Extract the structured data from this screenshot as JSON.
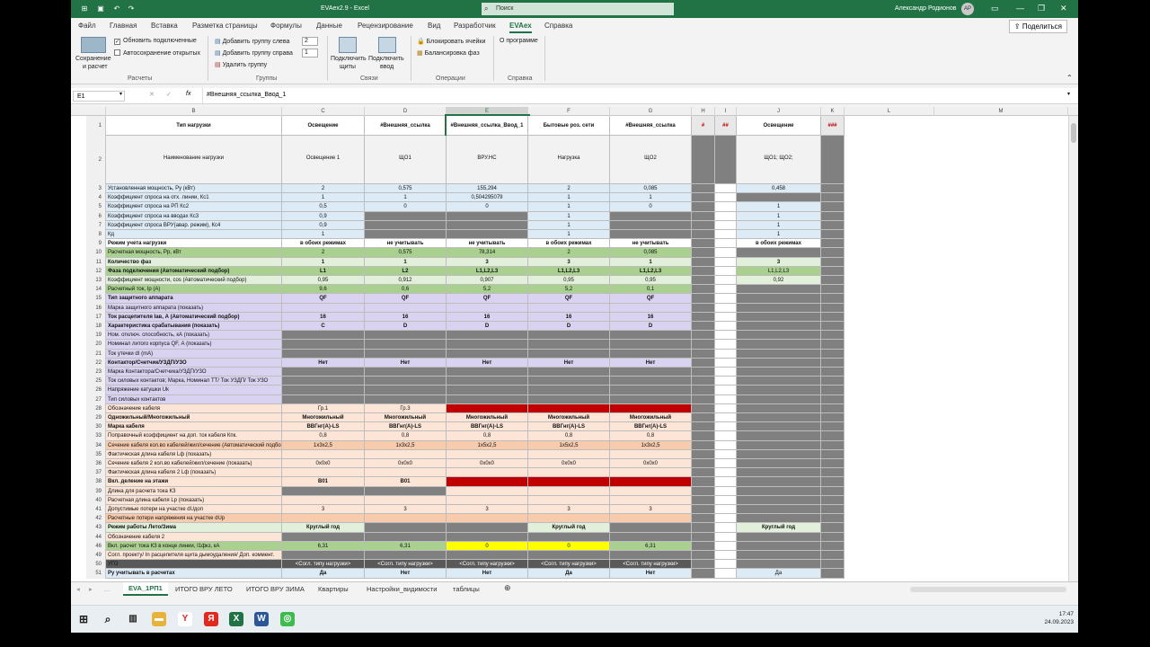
{
  "window": {
    "title": "EVAex2.9 - Excel",
    "search_placeholder": "Поиск",
    "user": "Александр Родионов",
    "avatar": "АР"
  },
  "ribbon_tabs": [
    "Файл",
    "Главная",
    "Вставка",
    "Разметка страницы",
    "Формулы",
    "Данные",
    "Рецензирование",
    "Вид",
    "Разработчик",
    "EVAex",
    "Справка"
  ],
  "active_tab": "EVAex",
  "share_label": "Поделиться",
  "ribbon": {
    "save_calc": [
      "Сохранение",
      "и расчет"
    ],
    "update_links": "Обновить подключенные",
    "autosave": "Автосохранение открытых",
    "add_group_left": "Добавить группу слева",
    "add_group_right": "Добавить группу справа",
    "delete_group": "Удалить группу",
    "spin_left": "2",
    "spin_right": "1",
    "connect_shields": [
      "Подключить",
      "щиты"
    ],
    "connect_input": [
      "Подключить",
      "ввод"
    ],
    "lock_cells": "Блокировать ячейки",
    "balance_phases": "Балансировка фаз",
    "about": "О программе",
    "groups": [
      "Расчеты",
      "Группы",
      "Связи",
      "Операции",
      "Справка"
    ]
  },
  "formula_bar": {
    "name_box": "E1",
    "formula": "#Внешняя_ссылка_Ввод_1"
  },
  "columns": [
    "B",
    "C",
    "D",
    "E",
    "F",
    "G",
    "H",
    "I",
    "J",
    "K",
    "L",
    "M"
  ],
  "header_row": {
    "C": "Освещение",
    "D": "#Внешняя_ссылка",
    "E": "#Внешняя_ссылка_Ввод_1",
    "F": "Бытовые роз. сети",
    "G": "#Внешняя_ссылка",
    "H": "#",
    "I": "##",
    "J": "Освещение",
    "K": "###",
    "B": "Тип нагрузки"
  },
  "name_row": {
    "B": "Наименование нагрузки",
    "C": "Освещение 1",
    "D": "ЩО1",
    "E": "ВРУ.НС",
    "F": "Нагрузка",
    "G": "ЩО2",
    "J": "ЩО1; ЩО2;"
  },
  "rows": [
    {
      "n": "3",
      "label": "Установленная мощность, Ру (кВт)",
      "C": "2",
      "D": "0,575",
      "E": "155,294",
      "F": "2",
      "G": "0,085",
      "J": "0,458"
    },
    {
      "n": "4",
      "label": "Коэффициент спроса на отх. линии, Кс1",
      "C": "1",
      "D": "1",
      "E": "0,504295079",
      "F": "1",
      "G": "1",
      "J": ""
    },
    {
      "n": "5",
      "label": "Коэффициент спроса на РП Кс2",
      "C": "0,5",
      "D": "0",
      "E": "0",
      "F": "1",
      "G": "0",
      "J": "1"
    },
    {
      "n": "6",
      "label": "Коэффициент спроса на вводах Кс3",
      "C": "0,9",
      "D": "",
      "E": "",
      "F": "1",
      "G": "",
      "J": "1"
    },
    {
      "n": "7",
      "label": "Коэффициент спроса ВРУ(авар. режим), Кс4",
      "C": "0,9",
      "D": "",
      "E": "",
      "F": "1",
      "G": "",
      "J": "1"
    },
    {
      "n": "8",
      "label": "Кд",
      "C": "1",
      "D": "",
      "E": "",
      "F": "1",
      "G": "",
      "J": "1"
    },
    {
      "n": "9",
      "label": "Режим учета нагрузки",
      "C": "в обоих режимах",
      "D": "не учитывать",
      "E": "не учитывать",
      "F": "в обоих режимах",
      "G": "не учитывать",
      "J": "в обоих режимах"
    },
    {
      "n": "10",
      "label": "Расчетная мощность, Рр, кВт",
      "C": "2",
      "D": "0,575",
      "E": "78,314",
      "F": "2",
      "G": "0,085",
      "J": ""
    },
    {
      "n": "11",
      "label": "Количество фаз",
      "C": "1",
      "D": "1",
      "E": "3",
      "F": "3",
      "G": "1",
      "J": "3"
    },
    {
      "n": "12",
      "label": "Фаза подключения (Автоматический подбор)",
      "C": "L1",
      "D": "L2",
      "E": "L1,L2,L3",
      "F": "L1,L2,L3",
      "G": "L1,L2,L3",
      "J": "L1,L2,L3"
    },
    {
      "n": "13",
      "label": "Коэффициент мощности, cos (Автоматический подбор)",
      "C": "0,95",
      "D": "0,912",
      "E": "0,907",
      "F": "0,95",
      "G": "0,95",
      "J": "0,92"
    },
    {
      "n": "14",
      "label": "Расчетный ток, Ip (A)",
      "C": "9,6",
      "D": "0,6",
      "E": "5,2",
      "F": "5,2",
      "G": "0,1",
      "J": ""
    },
    {
      "n": "15",
      "label": "Тип защитного аппарата",
      "C": "QF",
      "D": "QF",
      "E": "QF",
      "F": "QF",
      "G": "QF",
      "J": ""
    },
    {
      "n": "16",
      "label": "Марка защитного аппарата (показать)",
      "C": "",
      "D": "",
      "E": "",
      "F": "",
      "G": "",
      "J": ""
    },
    {
      "n": "17",
      "label": "Ток расцепителя Iав, А (Автоматический подбор)",
      "C": "16",
      "D": "16",
      "E": "16",
      "F": "16",
      "G": "16",
      "J": ""
    },
    {
      "n": "18",
      "label": "Характеристика срабатывания (показать)",
      "C": "C",
      "D": "D",
      "E": "D",
      "F": "D",
      "G": "D",
      "J": ""
    },
    {
      "n": "19",
      "label": "Ном. отключ. способность, кА (показать)",
      "C": "",
      "D": "",
      "E": "",
      "F": "",
      "G": "",
      "J": ""
    },
    {
      "n": "20",
      "label": "Номинал литого корпуса QF, А (показать)",
      "C": "",
      "D": "",
      "E": "",
      "F": "",
      "G": "",
      "J": ""
    },
    {
      "n": "21",
      "label": "Ток утечки dI (mA)",
      "C": "",
      "D": "",
      "E": "",
      "F": "",
      "G": "",
      "J": ""
    },
    {
      "n": "22",
      "label": "Контактор/Счетчик/УЗДП/УЗО",
      "C": "Нет",
      "D": "Нет",
      "E": "Нет",
      "F": "Нет",
      "G": "Нет",
      "J": ""
    },
    {
      "n": "23",
      "label": "Марка Контактора/Счетчика/УЗДП/УЗО",
      "C": "",
      "D": "",
      "E": "",
      "F": "",
      "G": "",
      "J": ""
    },
    {
      "n": "25",
      "label": "Ток силовых контактов; Марка, Номинал ТТ/ Ток УЗДП/ Ток УЗО",
      "C": "",
      "D": "",
      "E": "",
      "F": "",
      "G": "",
      "J": ""
    },
    {
      "n": "26",
      "label": "Напряжение катушки Uk",
      "C": "",
      "D": "",
      "E": "",
      "F": "",
      "G": "",
      "J": ""
    },
    {
      "n": "27",
      "label": "Тип силовых контактов",
      "C": "",
      "D": "",
      "E": "",
      "F": "",
      "G": "",
      "J": ""
    },
    {
      "n": "28",
      "label": "Обозначение кабеля",
      "C": "Гр.1",
      "D": "Гр.3",
      "E": "",
      "F": "",
      "G": "",
      "J": ""
    },
    {
      "n": "29",
      "label": "Одножильный/Многожильный",
      "C": "Многожильный",
      "D": "Многожильный",
      "E": "Многожильный",
      "F": "Многожильный",
      "G": "Многожильный",
      "J": ""
    },
    {
      "n": "30",
      "label": "Марка кабеля",
      "C": "ВВГнг(А)-LS",
      "D": "ВВГнг(А)-LS",
      "E": "ВВГнг(А)-LS",
      "F": "ВВГнг(А)-LS",
      "G": "ВВГнг(А)-LS",
      "J": ""
    },
    {
      "n": "33",
      "label": "Поправочный коэффициент на доп. ток кабеля Кпк.",
      "C": "0,8",
      "D": "0,8",
      "E": "0,8",
      "F": "0,8",
      "G": "0,8",
      "J": ""
    },
    {
      "n": "34",
      "label": "Сечение кабеля кол.во кабелей/жил/сечение (Автоматический подбор)",
      "C": "1х3х2,5",
      "D": "1х3х2,5",
      "E": "1х5х2,5",
      "F": "1х5х2,5",
      "G": "1х3х2,5",
      "J": ""
    },
    {
      "n": "35",
      "label": "Фактическая длина кабеля Lф (показать)",
      "C": "",
      "D": "",
      "E": "",
      "F": "",
      "G": "",
      "J": ""
    },
    {
      "n": "36",
      "label": "Сечение кабеля 2 кол.во кабелей/жил/сечение (показать)",
      "C": "0х0х0",
      "D": "0х0х0",
      "E": "0х0х0",
      "F": "0х0х0",
      "G": "0х0х0",
      "J": ""
    },
    {
      "n": "37",
      "label": "Фактическая длина кабеля 2 Lф (показать)",
      "C": "",
      "D": "",
      "E": "",
      "F": "",
      "G": "",
      "J": ""
    },
    {
      "n": "38",
      "label": "Вкл. деление на этажи",
      "C": "В01",
      "D": "В01",
      "E": "",
      "F": "",
      "G": "",
      "J": ""
    },
    {
      "n": "39",
      "label": "Длина для расчета тока КЗ",
      "C": "",
      "D": "",
      "E": "",
      "F": "",
      "G": "",
      "J": ""
    },
    {
      "n": "40",
      "label": "Расчетная длина кабеля Lр (показать)",
      "C": "",
      "D": "",
      "E": "",
      "F": "",
      "G": "",
      "J": ""
    },
    {
      "n": "41",
      "label": "Допустимые потери на участке dUдоп",
      "C": "3",
      "D": "3",
      "E": "3",
      "F": "3",
      "G": "3",
      "J": ""
    },
    {
      "n": "42",
      "label": "Расчетные потери напряжения на участке dUр",
      "C": "",
      "D": "",
      "E": "",
      "F": "",
      "G": "",
      "J": ""
    },
    {
      "n": "43",
      "label": "Режим работы Лето/Зима",
      "C": "Круглый год",
      "D": "",
      "E": "",
      "F": "Круглый год",
      "G": "",
      "J": "Круглый год"
    },
    {
      "n": "44",
      "label": "Обозначение кабеля 2",
      "C": "",
      "D": "",
      "E": "",
      "F": "",
      "G": "",
      "J": ""
    },
    {
      "n": "46",
      "label": "Вкл. расчет тока КЗ в конце линии, I1фкз, кА",
      "C": "6,31",
      "D": "6,31",
      "E": "0",
      "F": "0",
      "G": "6,31",
      "J": ""
    },
    {
      "n": "49",
      "label": "Согл. проекту/ In расцепителя щита дымоудаления/ Доп. коммент.",
      "C": "",
      "D": "",
      "E": "",
      "F": "",
      "G": "",
      "J": ""
    },
    {
      "n": "50",
      "label": "УГО",
      "C": "<Согл. типу нагрузки>",
      "D": "<Согл. типу нагрузки>",
      "E": "<Согл. типу нагрузки>",
      "F": "<Согл. типу нагрузки>",
      "G": "<Согл. типу нагрузки>",
      "J": ""
    },
    {
      "n": "51",
      "label": "Ру учитывать в расчетах",
      "C": "Да",
      "D": "Нет",
      "E": "Нет",
      "F": "Да",
      "G": "Нет",
      "J": "Да"
    }
  ],
  "sheet_tabs": [
    "EVA_1РП1",
    "ИТОГО ВРУ ЛЕТО",
    "ИТОГО ВРУ ЗИМА",
    "Квартиры",
    "Настройки_видимости",
    "таблицы"
  ],
  "active_sheet": "EVA_1РП1",
  "clock": {
    "time": "17:47",
    "date": "24.09.2023"
  },
  "colors": {
    "excel_green": "#217346",
    "green_row": "#a9d08e",
    "lavender": "#d9d2f0",
    "peach": "#fce4d6",
    "grey": "#808080",
    "red": "#c00000",
    "yellow": "#ffff00",
    "blue_tint": "#ddebf7"
  },
  "taskbar_icons": [
    "windows-icon",
    "search-icon",
    "taskview-icon",
    "explorer-icon",
    "yandex-browser-icon",
    "yandex-icon",
    "excel-icon",
    "word-icon",
    "app-icon"
  ]
}
